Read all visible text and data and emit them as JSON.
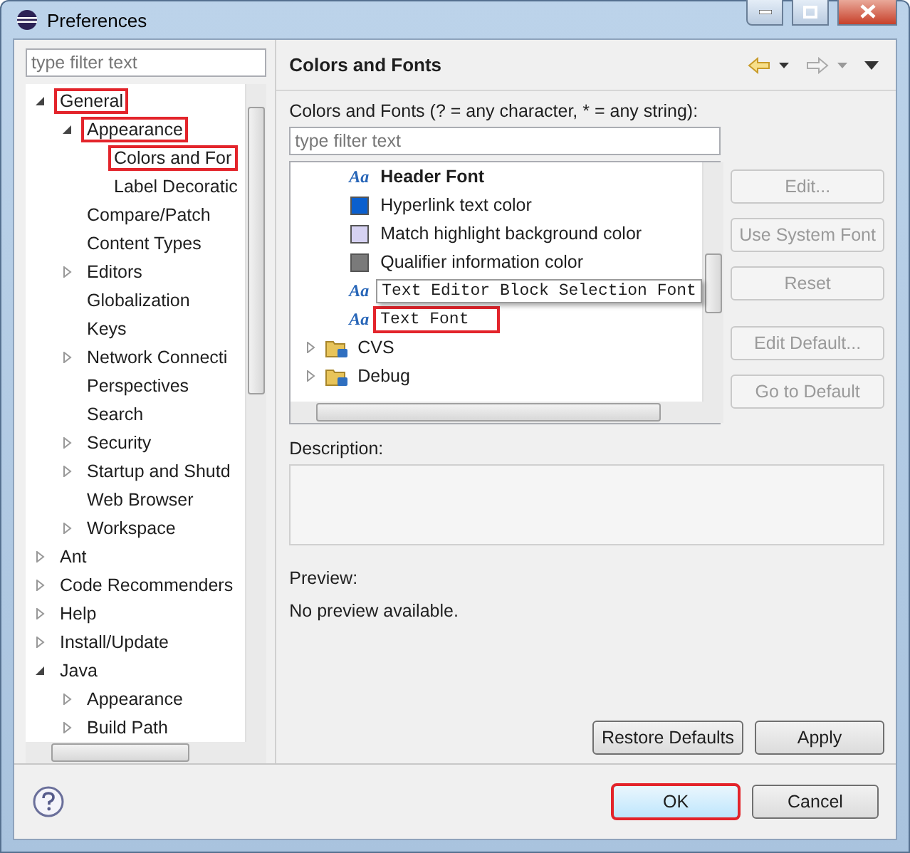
{
  "window": {
    "title": "Preferences"
  },
  "nav": {
    "filter_placeholder": "type filter text",
    "tree": [
      {
        "label": "General",
        "expanded": true,
        "highlighted": true,
        "children": [
          {
            "label": "Appearance",
            "expanded": true,
            "highlighted": true,
            "children": [
              {
                "label": "Colors and For",
                "highlighted": true
              },
              {
                "label": "Label Decoratic",
                "highlighted": false
              }
            ]
          },
          {
            "label": "Compare/Patch",
            "highlighted": false
          },
          {
            "label": "Content Types",
            "highlighted": false
          },
          {
            "label": "Editors",
            "expanded": false,
            "highlighted": false
          },
          {
            "label": "Globalization",
            "highlighted": false
          },
          {
            "label": "Keys",
            "highlighted": false
          },
          {
            "label": "Network Connecti",
            "expanded": false,
            "highlighted": false
          },
          {
            "label": "Perspectives",
            "highlighted": false
          },
          {
            "label": "Search",
            "highlighted": false
          },
          {
            "label": "Security",
            "expanded": false,
            "highlighted": false
          },
          {
            "label": "Startup and Shutd",
            "expanded": false,
            "highlighted": false
          },
          {
            "label": "Web Browser",
            "highlighted": false
          },
          {
            "label": "Workspace",
            "expanded": false,
            "highlighted": false
          }
        ]
      },
      {
        "label": "Ant",
        "expanded": false,
        "highlighted": false
      },
      {
        "label": "Code Recommenders",
        "expanded": false,
        "highlighted": false
      },
      {
        "label": "Help",
        "expanded": false,
        "highlighted": false
      },
      {
        "label": "Install/Update",
        "expanded": false,
        "highlighted": false
      },
      {
        "label": "Java",
        "expanded": true,
        "highlighted": false,
        "children": [
          {
            "label": "Appearance",
            "expanded": false,
            "highlighted": false
          },
          {
            "label": "Build Path",
            "expanded": false,
            "highlighted": false
          }
        ]
      }
    ]
  },
  "page": {
    "title": "Colors and Fonts",
    "filter_label": "Colors and Fonts (? = any character, * = any string):",
    "filter_placeholder": "type filter text",
    "items": [
      {
        "kind": "font",
        "icon": "Aa",
        "label": "Header Font",
        "bold": true,
        "monospace": false,
        "tooltip": false,
        "highlighted": false
      },
      {
        "kind": "color",
        "color": "#0a5fce",
        "label": "Hyperlink text color",
        "bold": false,
        "monospace": false,
        "tooltip": false,
        "highlighted": false
      },
      {
        "kind": "color",
        "color": "#d6d2f2",
        "label": "Match highlight background color",
        "bold": false,
        "monospace": false,
        "tooltip": false,
        "highlighted": false
      },
      {
        "kind": "color",
        "color": "#7a7a7a",
        "label": "Qualifier information color",
        "bold": false,
        "monospace": false,
        "tooltip": false,
        "highlighted": false
      },
      {
        "kind": "font",
        "icon": "Aa",
        "label": "Text Editor Block Selection Font",
        "bold": false,
        "monospace": true,
        "tooltip": true,
        "highlighted": false
      },
      {
        "kind": "font",
        "icon": "Aa",
        "label": "Text Font",
        "bold": false,
        "monospace": true,
        "tooltip": false,
        "highlighted": true
      },
      {
        "kind": "category",
        "label": "CVS",
        "expanded": false,
        "bold": false,
        "monospace": false,
        "tooltip": false,
        "highlighted": false
      },
      {
        "kind": "category",
        "label": "Debug",
        "expanded": false,
        "bold": false,
        "monospace": false,
        "tooltip": false,
        "highlighted": false
      }
    ],
    "side_buttons": [
      {
        "label": "Edit...",
        "disabled": true
      },
      {
        "label": "Use System Font",
        "disabled": true
      },
      {
        "label": "Reset",
        "disabled": true
      },
      {
        "label": "Edit Default...",
        "disabled": true
      },
      {
        "label": "Go to Default",
        "disabled": true
      }
    ],
    "description_label": "Description:",
    "preview_label": "Preview:",
    "preview_text": "No preview available.",
    "page_buttons": [
      "Restore Defaults",
      "Apply"
    ]
  },
  "dialog_buttons": [
    {
      "label": "OK",
      "default": true,
      "highlighted": true
    },
    {
      "label": "Cancel",
      "default": false,
      "highlighted": false
    }
  ]
}
